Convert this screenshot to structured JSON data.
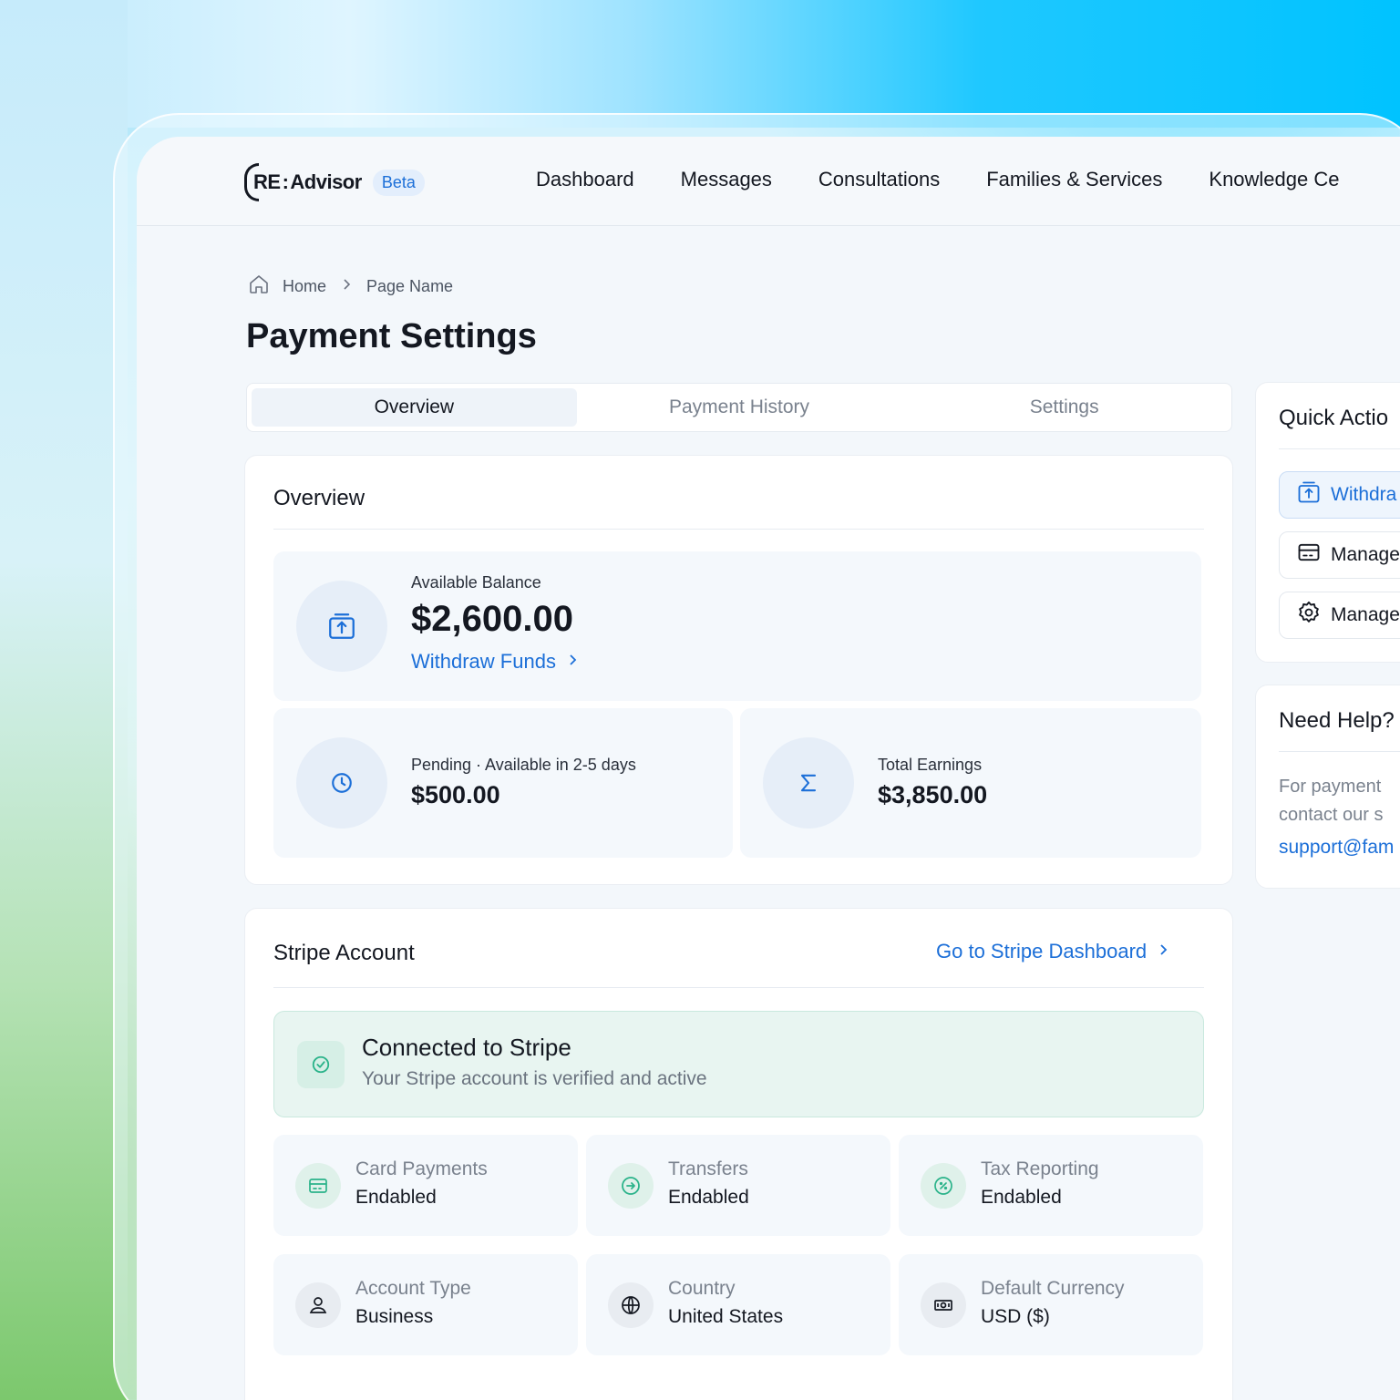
{
  "header": {
    "logo": {
      "re": "RE",
      "colon": ":",
      "advisor": "Advisor"
    },
    "beta_badge": "Beta",
    "nav": [
      "Dashboard",
      "Messages",
      "Consultations",
      "Families & Services",
      "Knowledge Ce"
    ]
  },
  "breadcrumb": {
    "home": "Home",
    "current": "Page Name",
    "home_icon": "home-icon",
    "separator_icon": "chevron-right-icon"
  },
  "page": {
    "title": "Payment Settings"
  },
  "tabs": {
    "items": [
      "Overview",
      "Payment History",
      "Settings"
    ],
    "active": "Overview"
  },
  "overview": {
    "title": "Overview",
    "available": {
      "label": "Available Balance",
      "value": "$2,600.00",
      "link": "Withdraw Funds",
      "icon": "withdraw-icon"
    },
    "pending": {
      "label": "Pending · Available in 2-5 days",
      "value": "$500.00",
      "icon": "clock-icon"
    },
    "total": {
      "label": "Total Earnings",
      "value": "$3,850.00",
      "icon": "sigma-icon"
    }
  },
  "stripe": {
    "title": "Stripe Account",
    "dashboard_link": "Go to Stripe Dashboard",
    "connected": {
      "title": "Connected to Stripe",
      "subtitle": "Your Stripe account is verified and active",
      "icon": "check-circle-icon"
    },
    "features": [
      {
        "label": "Card Payments",
        "value": "Endabled",
        "icon": "credit-card-icon"
      },
      {
        "label": "Transfers",
        "value": "Endabled",
        "icon": "arrow-right-circle-icon"
      },
      {
        "label": "Tax Reporting",
        "value": "Endabled",
        "icon": "percent-circle-icon"
      },
      {
        "label": "Account Type",
        "value": "Business",
        "icon": "user-icon"
      },
      {
        "label": "Country",
        "value": "United States",
        "icon": "globe-icon"
      },
      {
        "label": "Default Currency",
        "value": "USD ($)",
        "icon": "banknote-icon"
      }
    ]
  },
  "quick_actions": {
    "title": "Quick Actio",
    "buttons": [
      "Withdra",
      "Manage",
      "Manage"
    ]
  },
  "help": {
    "title": "Need Help?",
    "text_line1": "For payment",
    "text_line2": "contact our s",
    "email": "support@fam"
  },
  "colors": {
    "accent": "#1c6fd8",
    "success": "#2bb38a",
    "background": "#f3f7fb"
  }
}
